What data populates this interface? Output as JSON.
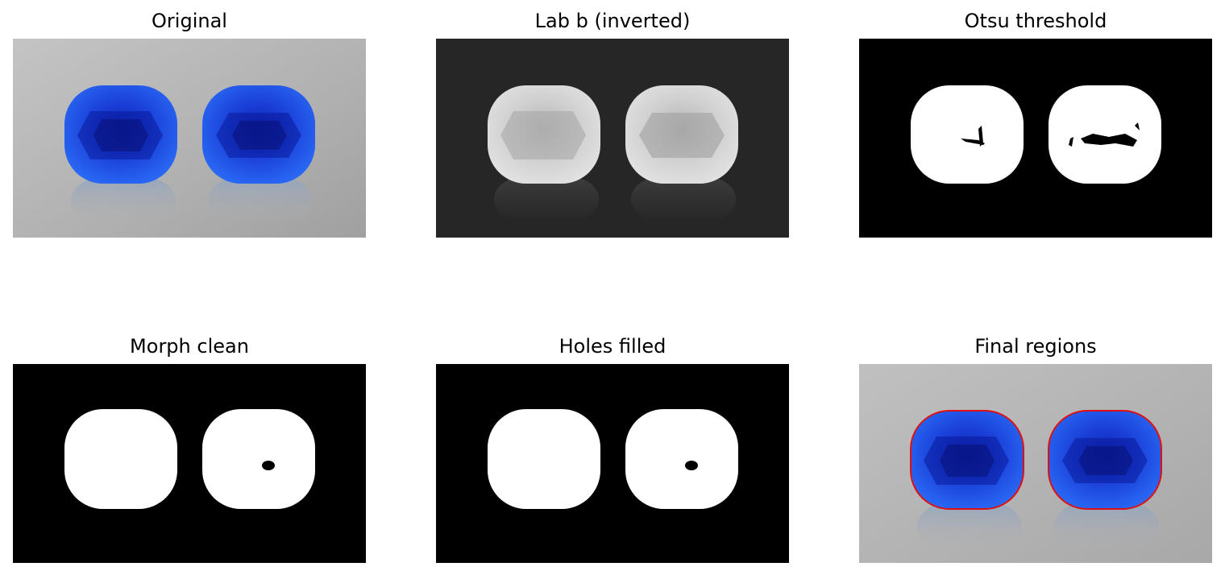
{
  "figure": {
    "panels": [
      {
        "title": "Original"
      },
      {
        "title": "Lab b (inverted)"
      },
      {
        "title": "Otsu threshold"
      },
      {
        "title": "Morph clean"
      },
      {
        "title": "Holes filled"
      },
      {
        "title": "Final regions"
      }
    ]
  },
  "colors": {
    "gem_blue": "#1a4fe6",
    "gem_dark": "#0a1aa8",
    "background_gray": "#b8b8b8",
    "contour_red": "#e01010"
  }
}
